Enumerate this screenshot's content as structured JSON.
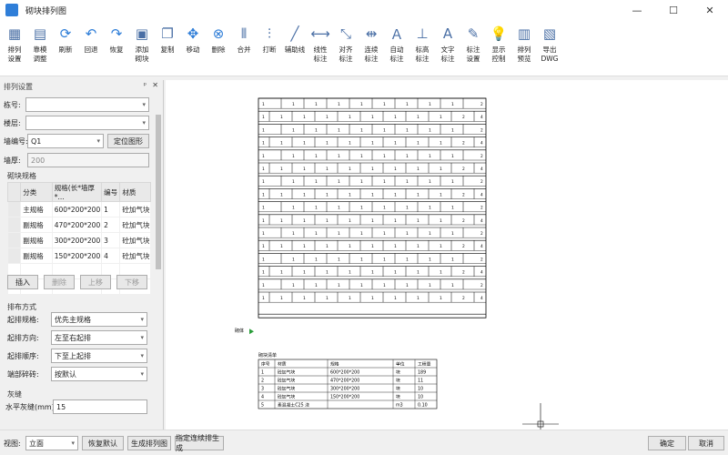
{
  "window": {
    "title": "砌块排列图",
    "minimize": "—",
    "maximize": "☐",
    "close": "✕"
  },
  "toolbar": [
    {
      "label": "排列\n设置",
      "icon": "arrange-settings-icon"
    },
    {
      "label": "靠模\n调整",
      "icon": "mold-adjust-icon"
    },
    {
      "label": "刷新",
      "icon": "refresh-icon"
    },
    {
      "label": "回退",
      "icon": "undo-icon"
    },
    {
      "label": "恢复",
      "icon": "redo-icon"
    },
    {
      "label": "添加\n砌块",
      "icon": "add-block-icon"
    },
    {
      "label": "复制",
      "icon": "copy-icon"
    },
    {
      "label": "移动",
      "icon": "move-icon"
    },
    {
      "label": "删除",
      "icon": "delete-icon"
    },
    {
      "label": "合并",
      "icon": "merge-icon"
    },
    {
      "label": "打断",
      "icon": "break-icon"
    },
    {
      "label": "辅助线",
      "icon": "auxiliary-line-icon"
    },
    {
      "label": "线性\n标注",
      "icon": "linear-dim-icon"
    },
    {
      "label": "对齐\n标注",
      "icon": "aligned-dim-icon"
    },
    {
      "label": "连续\n标注",
      "icon": "continuous-dim-icon"
    },
    {
      "label": "自动\n标注",
      "icon": "auto-dim-icon"
    },
    {
      "label": "标高\n标注",
      "icon": "elevation-dim-icon"
    },
    {
      "label": "文字\n标注",
      "icon": "text-annot-icon"
    },
    {
      "label": "标注\n设置",
      "icon": "annot-settings-icon"
    },
    {
      "label": "显示\n控制",
      "icon": "display-control-icon"
    },
    {
      "label": "排列\n预览",
      "icon": "arrange-preview-icon"
    },
    {
      "label": "导出\nDWG",
      "icon": "export-dwg-icon"
    }
  ],
  "panel": {
    "title": "排列设置",
    "pin": "ᵖ",
    "close": "✕",
    "building_label": "栋号:",
    "building_value": "",
    "floor_label": "楼层:",
    "floor_value": "",
    "wall_label": "墙编号:",
    "wall_value": "Q1",
    "locate_button": "定位图形",
    "thickness_label": "墙厚:",
    "thickness_value": "200",
    "spec_section": "砌块规格",
    "spec_headers": [
      "分类",
      "规格(长*墙厚*...",
      "编号",
      "材质"
    ],
    "spec_rows": [
      [
        "主规格",
        "600*200*200",
        "1",
        "砼加气块"
      ],
      [
        "副规格",
        "470*200*200",
        "2",
        "砼加气块"
      ],
      [
        "副规格",
        "300*200*200",
        "3",
        "砼加气块"
      ],
      [
        "副规格",
        "150*200*200",
        "4",
        "砼加气块"
      ]
    ],
    "insert_button": "插入",
    "delete_button": "删除",
    "up_button": "上移",
    "down_button": "下移",
    "layout_section": "排布方式",
    "start_spec_label": "起排规格:",
    "start_spec_value": "优先主规格",
    "direction_label": "起排方向:",
    "direction_value": "左至右起排",
    "order_label": "起排顺序:",
    "order_value": "下至上起排",
    "staggered_label": "端部碎砖:",
    "staggered_value": "按默认",
    "joint_section": "灰缝",
    "h_joint_label": "水平灰缝(mm)",
    "h_joint_value": "15"
  },
  "drawing": {
    "rows": 16,
    "row_labels": [
      "1",
      "2",
      "1",
      "2",
      "1",
      "2",
      "1",
      "2",
      "1",
      "2",
      "1",
      "2",
      "1",
      "2",
      "1",
      "2"
    ],
    "wall_mark": "砌体",
    "table_title": "砌块清单",
    "table_headers": [
      "序号",
      "材质",
      "规格",
      "单位",
      "工程量"
    ],
    "table_rows": [
      [
        "1",
        "砼加气块",
        "600*200*200",
        "块",
        "189"
      ],
      [
        "2",
        "砼加气块",
        "470*200*200",
        "块",
        "11"
      ],
      [
        "3",
        "砼加气块",
        "300*200*200",
        "块",
        "10"
      ],
      [
        "4",
        "砼加气块",
        "150*200*200",
        "块",
        "10"
      ],
      [
        "5",
        "素混凝土C25 浇",
        "",
        "m3",
        "0.10"
      ]
    ]
  },
  "bottom": {
    "view_label": "视图:",
    "view_value": "立面",
    "reset_button": "恢复默认",
    "generate_button": "生成排列图",
    "specify_button": "指定连续排生成",
    "ok_button": "确定",
    "cancel_button": "取消"
  },
  "colors": {
    "accent": "#2f7ed8",
    "panel": "#f0f0f0",
    "canvas": "#ffffff"
  }
}
